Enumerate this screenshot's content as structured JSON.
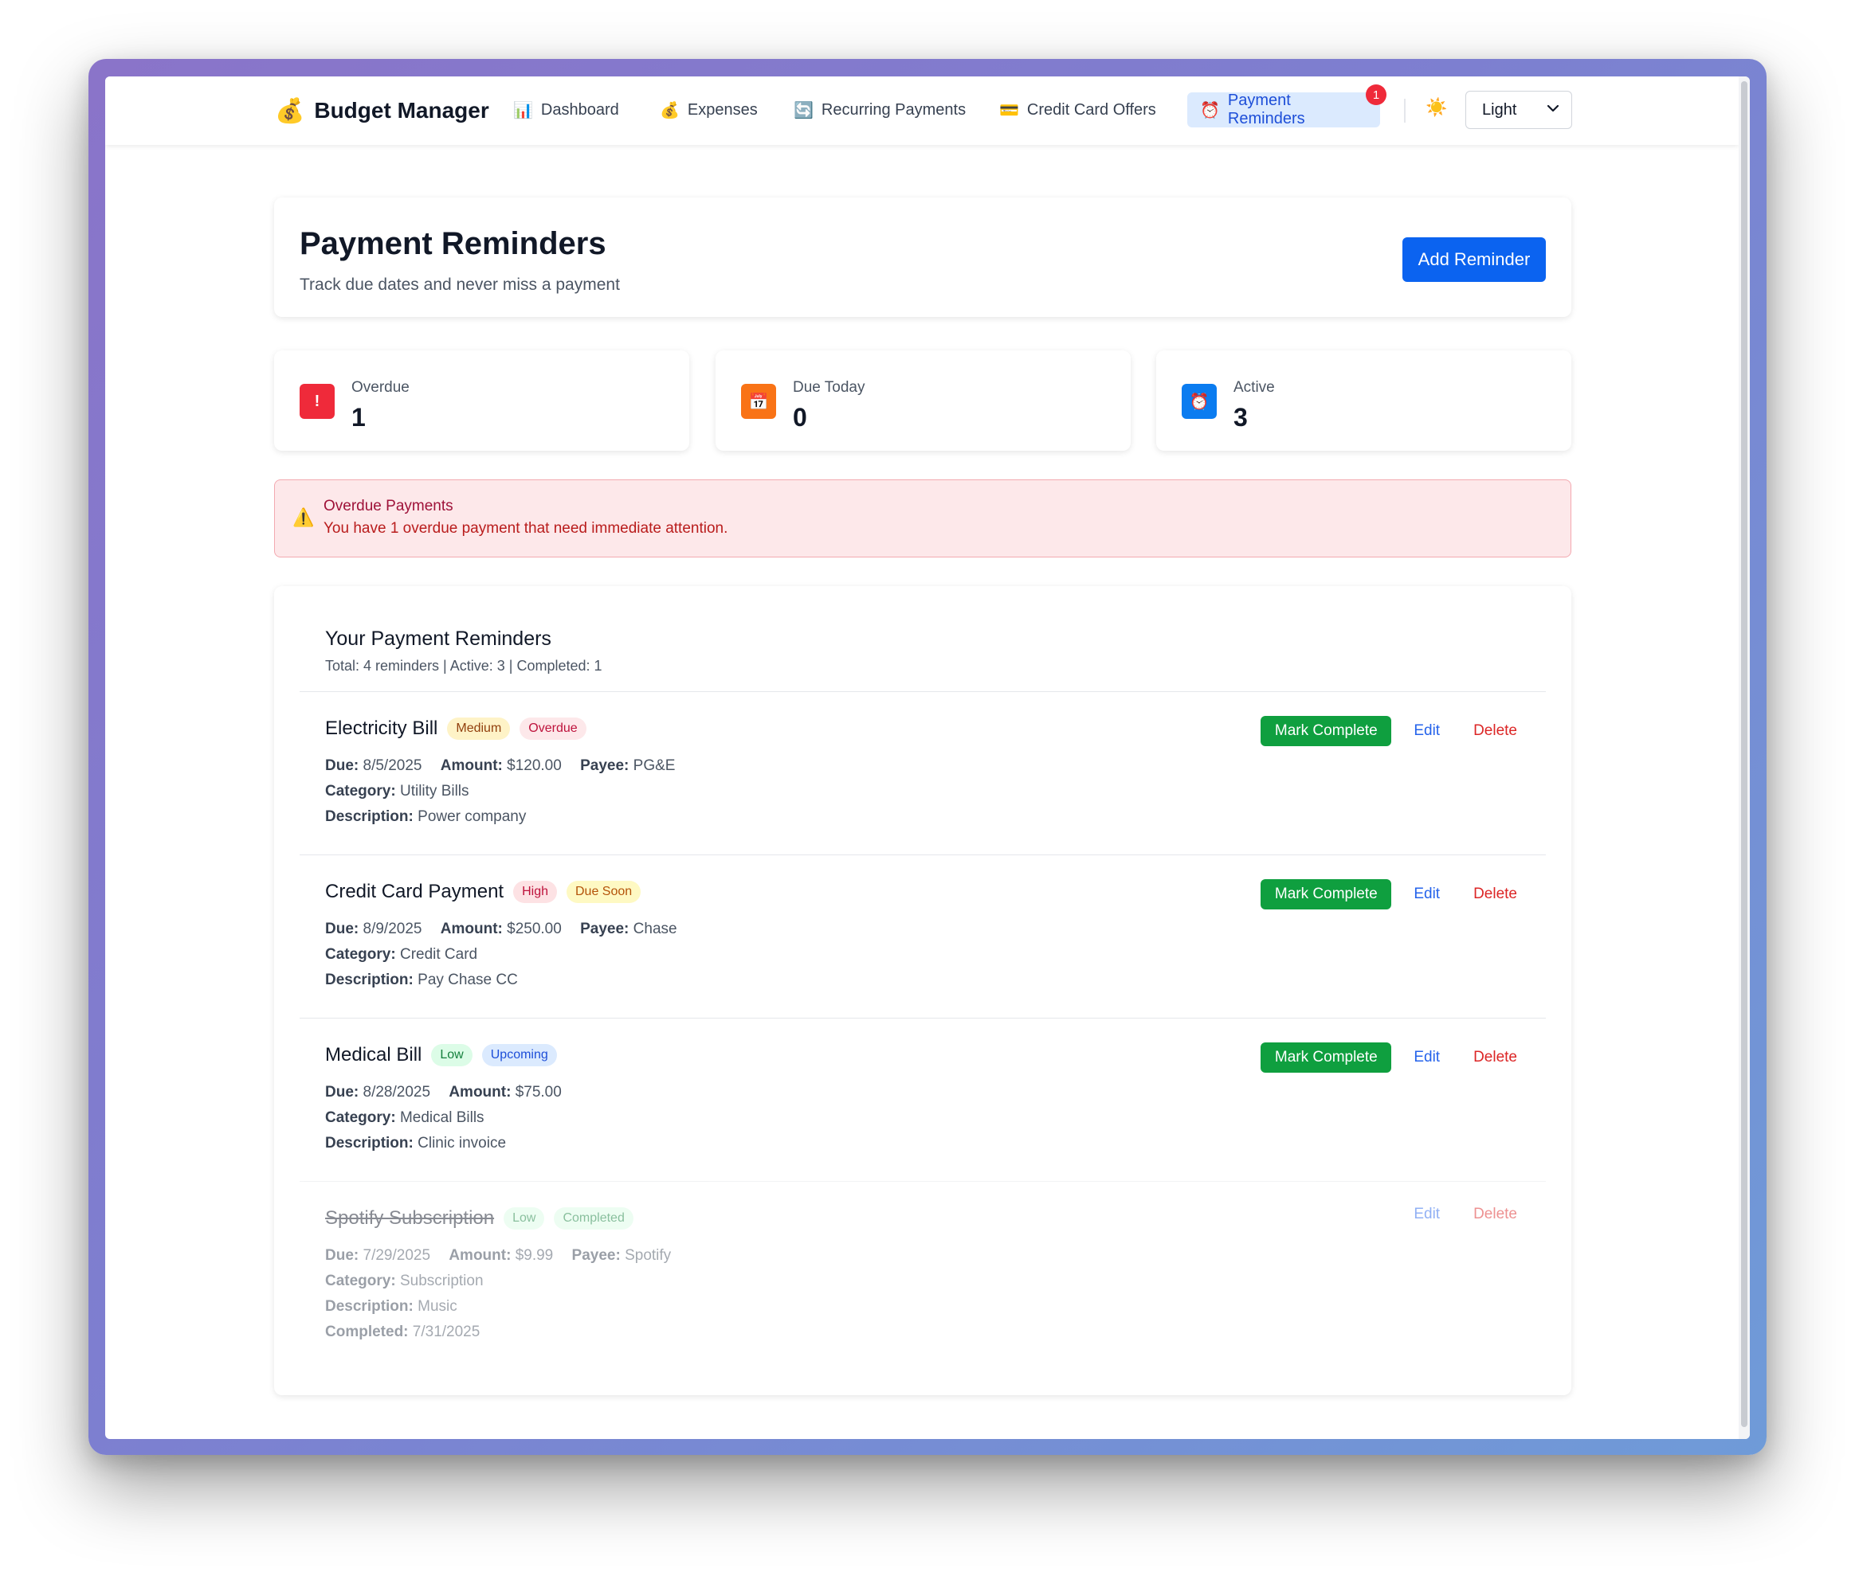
{
  "nav": {
    "brand_icon": "💰",
    "brand": "Budget Manager",
    "items": [
      {
        "icon": "📊",
        "label": "Dashboard"
      },
      {
        "icon": "💰",
        "label": "Expenses"
      },
      {
        "icon": "🔄",
        "label": "Recurring Payments"
      },
      {
        "icon": "💳",
        "label": "Credit Card Offers"
      },
      {
        "icon": "⏰",
        "label": "Payment Reminders",
        "badge": "1"
      }
    ],
    "theme_icon": "☀️",
    "theme_value": "Light"
  },
  "header": {
    "title": "Payment Reminders",
    "subtitle": "Track due dates and never miss a payment",
    "add_button": "Add Reminder"
  },
  "stats": [
    {
      "icon": "!",
      "label": "Overdue",
      "value": "1",
      "color": "#ef2a3a"
    },
    {
      "icon": "📅",
      "label": "Due Today",
      "value": "0",
      "color": "#f97316"
    },
    {
      "icon": "⏰",
      "label": "Active",
      "value": "3",
      "color": "#0b7cf0"
    }
  ],
  "alert": {
    "icon": "⚠️",
    "title": "Overdue Payments",
    "text": "You have 1 overdue payment that need immediate attention."
  },
  "list": {
    "title": "Your Payment Reminders",
    "summary": "Total: 4 reminders | Active: 3 | Completed: 1",
    "actions": {
      "mark": "Mark Complete",
      "edit": "Edit",
      "delete": "Delete"
    },
    "labels": {
      "due": "Due:",
      "amount": "Amount:",
      "payee": "Payee:",
      "category": "Category:",
      "description": "Description:",
      "completed": "Completed:"
    },
    "reminders": [
      {
        "name": "Electricity Bill",
        "priority": "Medium",
        "status": "Overdue",
        "due": "8/5/2025",
        "amount": "$120.00",
        "payee": "PG&E",
        "category": "Utility Bills",
        "description": "Power company"
      },
      {
        "name": "Credit Card Payment",
        "priority": "High",
        "status": "Due Soon",
        "due": "8/9/2025",
        "amount": "$250.00",
        "payee": "Chase",
        "category": "Credit Card",
        "description": "Pay Chase CC"
      },
      {
        "name": "Medical Bill",
        "priority": "Low",
        "status": "Upcoming",
        "due": "8/28/2025",
        "amount": "$75.00",
        "category": "Medical Bills",
        "description": "Clinic invoice"
      },
      {
        "name": "Spotify Subscription",
        "priority": "Low",
        "status": "Completed",
        "due": "7/29/2025",
        "amount": "$9.99",
        "payee": "Spotify",
        "category": "Subscription",
        "description": "Music",
        "completed": "7/31/2025"
      }
    ]
  }
}
